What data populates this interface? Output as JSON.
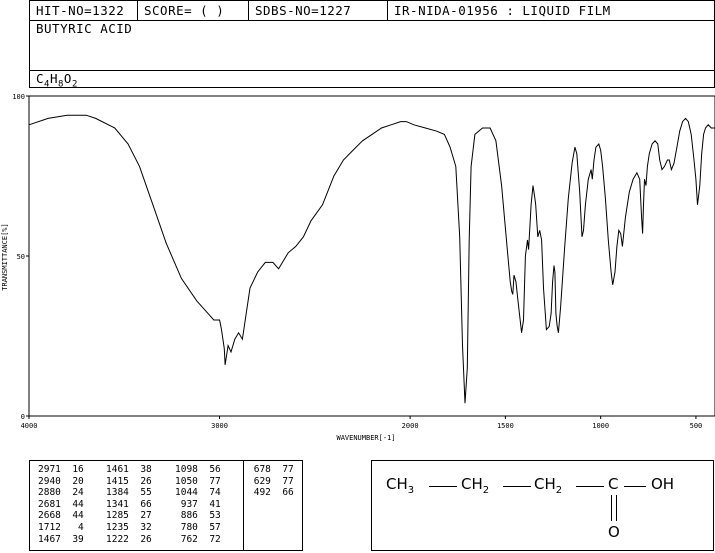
{
  "header": {
    "hit_no": "HIT-NO=1322",
    "score": "SCORE=  (   )",
    "sdbs_no": "SDBS-NO=1227",
    "ir_id": "IR-NIDA-01956 : LIQUID FILM",
    "compound_name": "BUTYRIC ACID",
    "formula": {
      "c": "C",
      "c_n": "4",
      "h": "H",
      "h_n": "8",
      "o": "O",
      "o_n": "2"
    }
  },
  "chart_data": {
    "type": "line",
    "xlabel": "WAVENUMBER[-1]",
    "ylabel": "TRANSMITTANCE[%]",
    "xlim": [
      4000,
      400
    ],
    "ylim": [
      0,
      100
    ],
    "x_ticks": [
      4000,
      3000,
      2000,
      1500,
      1000,
      500
    ],
    "y_ticks": [
      0,
      50,
      100
    ],
    "grid": false,
    "series": [
      {
        "points": [
          [
            4000,
            91
          ],
          [
            3900,
            93
          ],
          [
            3800,
            94
          ],
          [
            3700,
            94
          ],
          [
            3650,
            93
          ],
          [
            3550,
            90
          ],
          [
            3480,
            85
          ],
          [
            3420,
            78
          ],
          [
            3350,
            66
          ],
          [
            3280,
            54
          ],
          [
            3200,
            43
          ],
          [
            3120,
            36
          ],
          [
            3060,
            32
          ],
          [
            3030,
            30
          ],
          [
            3000,
            30
          ],
          [
            2990,
            27
          ],
          [
            2975,
            21
          ],
          [
            2971,
            16
          ],
          [
            2955,
            22
          ],
          [
            2940,
            20
          ],
          [
            2920,
            24
          ],
          [
            2900,
            26
          ],
          [
            2880,
            24
          ],
          [
            2860,
            32
          ],
          [
            2840,
            40
          ],
          [
            2800,
            45
          ],
          [
            2760,
            48
          ],
          [
            2720,
            48
          ],
          [
            2690,
            46
          ],
          [
            2680,
            47
          ],
          [
            2640,
            51
          ],
          [
            2600,
            53
          ],
          [
            2560,
            56
          ],
          [
            2520,
            61
          ],
          [
            2460,
            66
          ],
          [
            2400,
            75
          ],
          [
            2350,
            80
          ],
          [
            2300,
            83
          ],
          [
            2250,
            86
          ],
          [
            2200,
            88
          ],
          [
            2150,
            90
          ],
          [
            2100,
            91
          ],
          [
            2050,
            92
          ],
          [
            2020,
            92
          ],
          [
            1980,
            91
          ],
          [
            1920,
            90
          ],
          [
            1860,
            89
          ],
          [
            1820,
            88
          ],
          [
            1790,
            84
          ],
          [
            1760,
            78
          ],
          [
            1740,
            56
          ],
          [
            1725,
            22
          ],
          [
            1712,
            4
          ],
          [
            1700,
            15
          ],
          [
            1690,
            55
          ],
          [
            1680,
            78
          ],
          [
            1660,
            88
          ],
          [
            1620,
            90
          ],
          [
            1580,
            90
          ],
          [
            1550,
            86
          ],
          [
            1520,
            72
          ],
          [
            1490,
            52
          ],
          [
            1475,
            42
          ],
          [
            1467,
            39
          ],
          [
            1461,
            38
          ],
          [
            1455,
            44
          ],
          [
            1445,
            42
          ],
          [
            1430,
            34
          ],
          [
            1415,
            26
          ],
          [
            1405,
            30
          ],
          [
            1395,
            50
          ],
          [
            1384,
            55
          ],
          [
            1378,
            52
          ],
          [
            1365,
            66
          ],
          [
            1355,
            72
          ],
          [
            1345,
            68
          ],
          [
            1341,
            66
          ],
          [
            1330,
            56
          ],
          [
            1320,
            58
          ],
          [
            1310,
            55
          ],
          [
            1300,
            40
          ],
          [
            1285,
            27
          ],
          [
            1270,
            28
          ],
          [
            1260,
            32
          ],
          [
            1252,
            42
          ],
          [
            1245,
            47
          ],
          [
            1240,
            45
          ],
          [
            1235,
            32
          ],
          [
            1228,
            28
          ],
          [
            1222,
            26
          ],
          [
            1210,
            34
          ],
          [
            1190,
            52
          ],
          [
            1170,
            68
          ],
          [
            1150,
            79
          ],
          [
            1135,
            84
          ],
          [
            1125,
            82
          ],
          [
            1110,
            70
          ],
          [
            1098,
            56
          ],
          [
            1090,
            58
          ],
          [
            1080,
            66
          ],
          [
            1065,
            74
          ],
          [
            1050,
            77
          ],
          [
            1044,
            74
          ],
          [
            1035,
            80
          ],
          [
            1025,
            84
          ],
          [
            1010,
            85
          ],
          [
            1000,
            83
          ],
          [
            990,
            78
          ],
          [
            975,
            68
          ],
          [
            960,
            55
          ],
          [
            945,
            45
          ],
          [
            937,
            41
          ],
          [
            925,
            45
          ],
          [
            915,
            53
          ],
          [
            905,
            58
          ],
          [
            895,
            57
          ],
          [
            886,
            53
          ],
          [
            870,
            62
          ],
          [
            850,
            70
          ],
          [
            830,
            74
          ],
          [
            810,
            76
          ],
          [
            795,
            74
          ],
          [
            785,
            62
          ],
          [
            780,
            57
          ],
          [
            775,
            66
          ],
          [
            770,
            74
          ],
          [
            762,
            72
          ],
          [
            755,
            78
          ],
          [
            745,
            82
          ],
          [
            730,
            85
          ],
          [
            715,
            86
          ],
          [
            700,
            85
          ],
          [
            690,
            80
          ],
          [
            678,
            77
          ],
          [
            665,
            78
          ],
          [
            650,
            80
          ],
          [
            640,
            80
          ],
          [
            629,
            77
          ],
          [
            615,
            79
          ],
          [
            600,
            84
          ],
          [
            585,
            89
          ],
          [
            570,
            92
          ],
          [
            555,
            93
          ],
          [
            540,
            92
          ],
          [
            525,
            88
          ],
          [
            510,
            80
          ],
          [
            500,
            74
          ],
          [
            492,
            66
          ],
          [
            480,
            72
          ],
          [
            470,
            82
          ],
          [
            460,
            88
          ],
          [
            450,
            90
          ],
          [
            435,
            91
          ],
          [
            420,
            90
          ],
          [
            400,
            90
          ]
        ]
      }
    ],
    "peaks": [
      [
        2971,
        16
      ],
      [
        1461,
        38
      ],
      [
        1098,
        56
      ],
      [
        678,
        77
      ],
      [
        2940,
        20
      ],
      [
        1415,
        26
      ],
      [
        1050,
        77
      ],
      [
        629,
        77
      ],
      [
        2880,
        24
      ],
      [
        1384,
        55
      ],
      [
        1044,
        74
      ],
      [
        492,
        66
      ],
      [
        2681,
        44
      ],
      [
        1341,
        66
      ],
      [
        937,
        41
      ],
      [
        2668,
        44
      ],
      [
        1285,
        27
      ],
      [
        886,
        53
      ],
      [
        1712,
        4
      ],
      [
        1235,
        32
      ],
      [
        780,
        57
      ],
      [
        1467,
        39
      ],
      [
        1222,
        26
      ],
      [
        762,
        72
      ]
    ]
  },
  "peak_table": {
    "col1": [
      "2971  16",
      "2940  20",
      "2880  24",
      "2681  44",
      "2668  44",
      "1712   4",
      "1467  39"
    ],
    "col2": [
      "1461  38",
      "1415  26",
      "1384  55",
      "1341  66",
      "1285  27",
      "1235  32",
      "1222  26"
    ],
    "col3": [
      "1098  56",
      "1050  77",
      "1044  74",
      " 937  41",
      " 886  53",
      " 780  57",
      " 762  72"
    ],
    "col4": [
      " 678  77",
      " 629  77",
      " 492  66"
    ]
  },
  "structure": {
    "ch3": "CH",
    "ch3_sub": "3",
    "ch2a": "CH",
    "ch2a_sub": "2",
    "ch2b": "CH",
    "ch2b_sub": "2",
    "c": "C",
    "oh": "OH",
    "o": "O"
  }
}
